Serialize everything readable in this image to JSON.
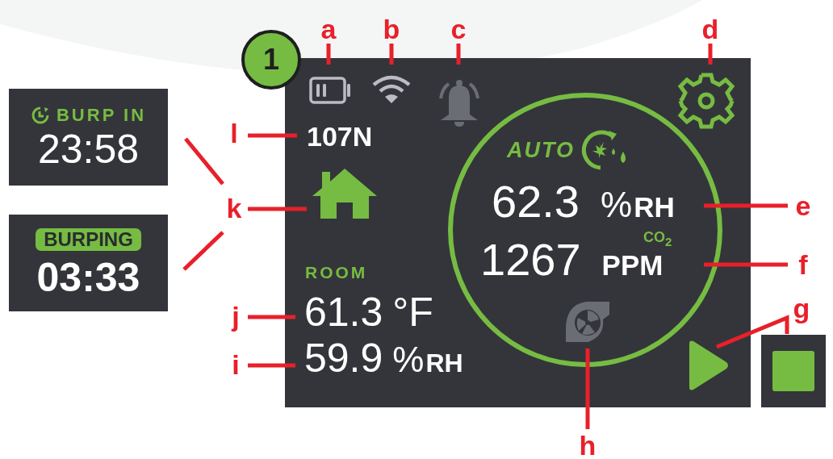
{
  "step_badge": "1",
  "screen": {
    "device_id": "107N",
    "mode_label": "AUTO",
    "humidity": {
      "value": "62.3",
      "unit": "%",
      "suffix": "RH"
    },
    "co2": {
      "label": "CO$_{2}$",
      "value": "1267",
      "unit": "PPM"
    },
    "room": {
      "label": "ROOM",
      "temperature": "61.3",
      "temperature_unit": "°F",
      "humidity": "59.9",
      "humidity_unit": "%",
      "humidity_suffix": "RH"
    }
  },
  "timer_panels": [
    {
      "kind": "countdown",
      "label": "BURP IN",
      "time": "23:58"
    },
    {
      "kind": "active",
      "label": "BURPING",
      "time": "03:33"
    }
  ],
  "callouts": [
    {
      "letter": "a"
    },
    {
      "letter": "b"
    },
    {
      "letter": "c"
    },
    {
      "letter": "d"
    },
    {
      "letter": "l"
    },
    {
      "letter": "k"
    },
    {
      "letter": "e"
    },
    {
      "letter": "f"
    },
    {
      "letter": "j"
    },
    {
      "letter": "g"
    },
    {
      "letter": "i"
    },
    {
      "letter": "h"
    }
  ]
}
